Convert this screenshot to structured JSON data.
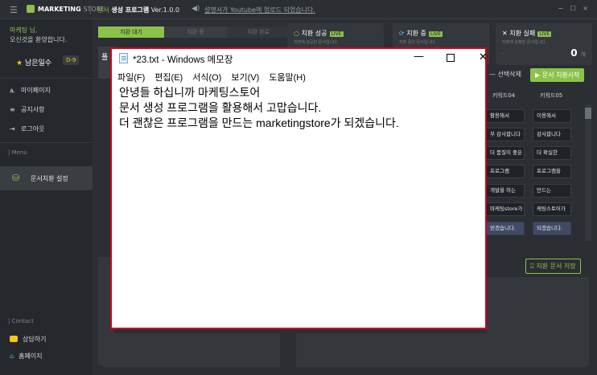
{
  "titlebar": {
    "menu_icon": "hamburger-icon",
    "logo_main": "MARKETING",
    "logo_sub": "STORE",
    "app_prefix": "문서",
    "app_name": "생성 프로그램",
    "app_version": "Ver.1.0.0",
    "notice": "설명서가 Youtube에 업로드 되었습니다.",
    "window_controls": "− ☐ ×"
  },
  "sidebar": {
    "greeting_name": "마케팅 님,",
    "greeting_msg": "오신것을 환영합니다.",
    "days_label": "남은일수",
    "days_badge": "D-9",
    "items": [
      {
        "label": "마이페이지",
        "icon": "person-icon"
      },
      {
        "label": "공지사항",
        "icon": "list-icon"
      },
      {
        "label": "로그아웃",
        "icon": "logout-icon"
      }
    ],
    "menu_section": "| Menu",
    "active_item": "문서치환 설정",
    "contact_section": "| Contact",
    "contact_items": [
      {
        "label": "상담하기",
        "icon": "chat-icon"
      },
      {
        "label": "홈페이지",
        "icon": "home-icon"
      }
    ]
  },
  "steps": [
    "치환 대기",
    "치환 중",
    "치환 완료"
  ],
  "cards": [
    {
      "title": "치환 성공",
      "live": "LIVE",
      "sub": "치환에 성공한 문서입니다."
    },
    {
      "title": "치환 중",
      "live": "LIVE",
      "sub": "치환 중인 문서입니다."
    },
    {
      "title": "치환 실패",
      "live": "LIVE",
      "sub": "치환에 실패한 문서입니다.",
      "value": "0",
      "unit": "개",
      "dash": "-"
    }
  ],
  "panel": {
    "left_label": "폴",
    "delete_button": "— 선택삭제",
    "start_button": "문서 치환시작",
    "save_button": "치환 문서 저장"
  },
  "table": {
    "headers": [
      "키워드04",
      "키워드05"
    ],
    "rows": [
      [
        "활용해서",
        "이용해서"
      ],
      [
        "무 감사합니다",
        "감사합니다"
      ],
      [
        "더 품질이 좋은",
        "더 확실한"
      ],
      [
        "프로그램",
        "프로그램을"
      ],
      [
        "개발을 하는",
        "만드는"
      ],
      [
        "마케팅store가",
        "케팅스토어가"
      ],
      [
        "얻겠습니다.",
        "되겠습니다."
      ]
    ]
  },
  "notepad": {
    "title": "*23.txt - Windows 메모장",
    "minimize": "—",
    "close": "✕",
    "menu": [
      "파일(F)",
      "편집(E)",
      "서식(O)",
      "보기(V)",
      "도움말(H)"
    ],
    "lines": [
      "안녕들 하십니까 마케팅스토어",
      "문서 생성 프로그램을 활용해서 고맙습니다.",
      "더 괜찮은 프로그램을 만드는 marketingstore가 되겠습니다."
    ]
  }
}
